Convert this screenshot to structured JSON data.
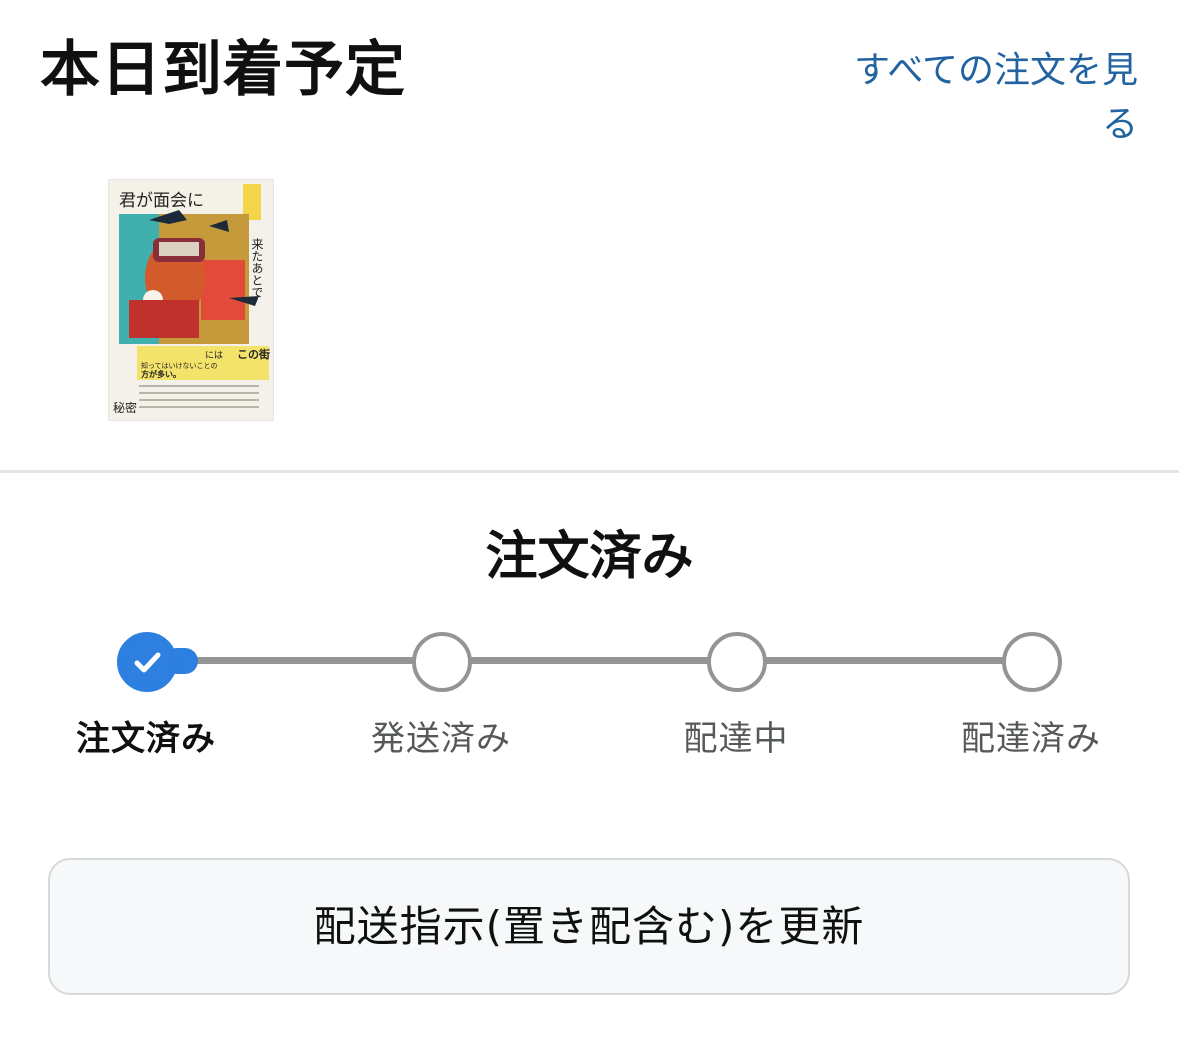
{
  "header": {
    "title": "本日到着予定",
    "all_orders_link": "すべての注文を見る"
  },
  "product": {
    "cover": {
      "top_title": "君が面会に",
      "side_title": "来たあとで",
      "tagline_1": "この街",
      "tagline_2": "には",
      "tagline_3": "知ってはいけないことの",
      "tagline_4": "方が多い。",
      "author": "秘密"
    }
  },
  "tracking": {
    "current_status": "注文済み",
    "steps": [
      {
        "label": "注文済み",
        "state": "done"
      },
      {
        "label": "発送済み",
        "state": "pending"
      },
      {
        "label": "配達中",
        "state": "pending"
      },
      {
        "label": "配達済み",
        "state": "pending"
      }
    ]
  },
  "actions": {
    "update_delivery_label": "配送指示(置き配含む)を更新"
  },
  "colors": {
    "accent": "#2d7fe0",
    "link": "#2162a1",
    "track": "#949494",
    "text": "#0f1111",
    "muted": "#565959"
  }
}
